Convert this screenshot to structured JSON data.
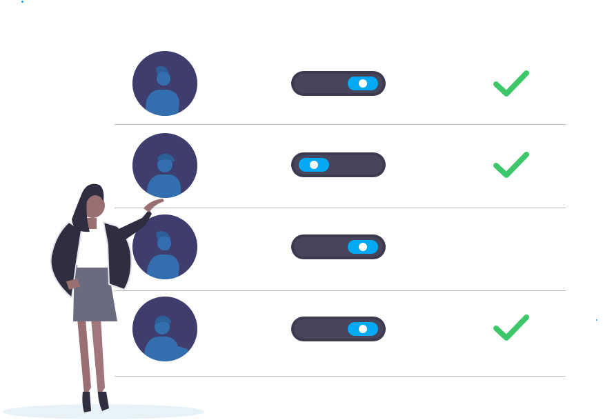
{
  "colors": {
    "avatar_bg": "#3f3d6e",
    "silhouette": "#2f6aa6",
    "toggle_track": "#3b3a4e",
    "toggle_knob": "#03a9f4",
    "check": "#3ec66b",
    "divider": "#b7b7bf",
    "floor": "#e6f1f8"
  },
  "rows": [
    {
      "avatar_icon": "female-user-icon",
      "toggle_on": true,
      "checked": true
    },
    {
      "avatar_icon": "male-user-icon",
      "toggle_on": false,
      "checked": true
    },
    {
      "avatar_icon": "female-user-icon",
      "toggle_on": true,
      "checked": false
    },
    {
      "avatar_icon": "male-user-icon",
      "toggle_on": true,
      "checked": true
    }
  ],
  "illustration": {
    "figure": "woman-presenting-icon"
  }
}
